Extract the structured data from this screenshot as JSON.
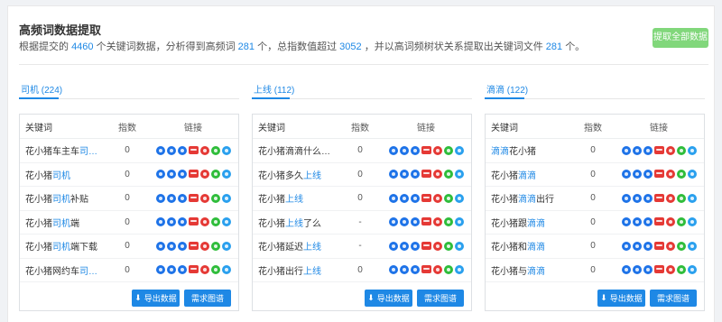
{
  "header": {
    "title": "高频词数据提取",
    "summary_prefix": "根据提交的",
    "keyword_count": "4460",
    "summary_mid1": "个关键词数据，分析得到高频词",
    "hf_count": "281",
    "summary_mid2": "个，总指数值超过",
    "index_total": "3052",
    "summary_mid3": "，并以高词频树状关系提取出关键词文件",
    "file_count": "281",
    "summary_suffix": "个。",
    "extract_all_label": "提取全部数据"
  },
  "columns": [
    {
      "tab_label": "司机 (224)",
      "table_headers": [
        "关键词",
        "指数",
        "链接"
      ],
      "rows": [
        {
          "pre": "花小猪车主车",
          "hl": "司…",
          "post": "",
          "index": "0"
        },
        {
          "pre": "花小猪",
          "hl": "司机",
          "post": "",
          "index": "0"
        },
        {
          "pre": "花小猪",
          "hl": "司机",
          "post": "补贴",
          "index": "0"
        },
        {
          "pre": "花小猪",
          "hl": "司机",
          "post": "端",
          "index": "0"
        },
        {
          "pre": "花小猪",
          "hl": "司机",
          "post": "端下载",
          "index": "0"
        },
        {
          "pre": "花小猪网约车",
          "hl": "司…",
          "post": "",
          "index": "0"
        }
      ],
      "export_label": "导出数据",
      "need_label": "需求图谱"
    },
    {
      "tab_label": "上线 (112)",
      "table_headers": [
        "关键词",
        "指数",
        "链接"
      ],
      "rows": [
        {
          "pre": "花小猪滴滴什么…",
          "hl": "",
          "post": "",
          "index": "0"
        },
        {
          "pre": "花小猪多久",
          "hl": "上线",
          "post": "",
          "index": "0"
        },
        {
          "pre": "花小猪",
          "hl": "上线",
          "post": "",
          "index": "0"
        },
        {
          "pre": "花小猪",
          "hl": "上线",
          "post": "了么",
          "index": "-"
        },
        {
          "pre": "花小猪延迟",
          "hl": "上线",
          "post": "",
          "index": "-"
        },
        {
          "pre": "花小猪出行",
          "hl": "上线",
          "post": "",
          "index": "0"
        }
      ],
      "export_label": "导出数据",
      "need_label": "需求图谱"
    },
    {
      "tab_label": "滴滴 (122)",
      "table_headers": [
        "关键词",
        "指数",
        "链接"
      ],
      "rows": [
        {
          "pre": "",
          "hl": "滴滴",
          "post": "花小猪",
          "index": "0"
        },
        {
          "pre": "花小猪",
          "hl": "滴滴",
          "post": "",
          "index": "0"
        },
        {
          "pre": "花小猪",
          "hl": "滴滴",
          "post": "出行",
          "index": "0"
        },
        {
          "pre": "花小猪跟",
          "hl": "滴滴",
          "post": "",
          "index": "0"
        },
        {
          "pre": "花小猪和",
          "hl": "滴滴",
          "post": "",
          "index": "0"
        },
        {
          "pre": "花小猪与",
          "hl": "滴滴",
          "post": "",
          "index": "0"
        }
      ],
      "export_label": "导出数据",
      "need_label": "需求图谱"
    }
  ],
  "link_icons": [
    {
      "name": "baidu-pc-icon",
      "color": "#1e73e8"
    },
    {
      "name": "baidu-mobile-icon",
      "color": "#1e73e8"
    },
    {
      "name": "360-search-icon",
      "color": "#1e73e8"
    },
    {
      "name": "toutiao-icon",
      "color": "#e53935"
    },
    {
      "name": "weibo-icon",
      "color": "#e53935"
    },
    {
      "name": "wechat-icon",
      "color": "#2fbd3b"
    },
    {
      "name": "zhihu-icon",
      "color": "#2aa0ee"
    }
  ]
}
